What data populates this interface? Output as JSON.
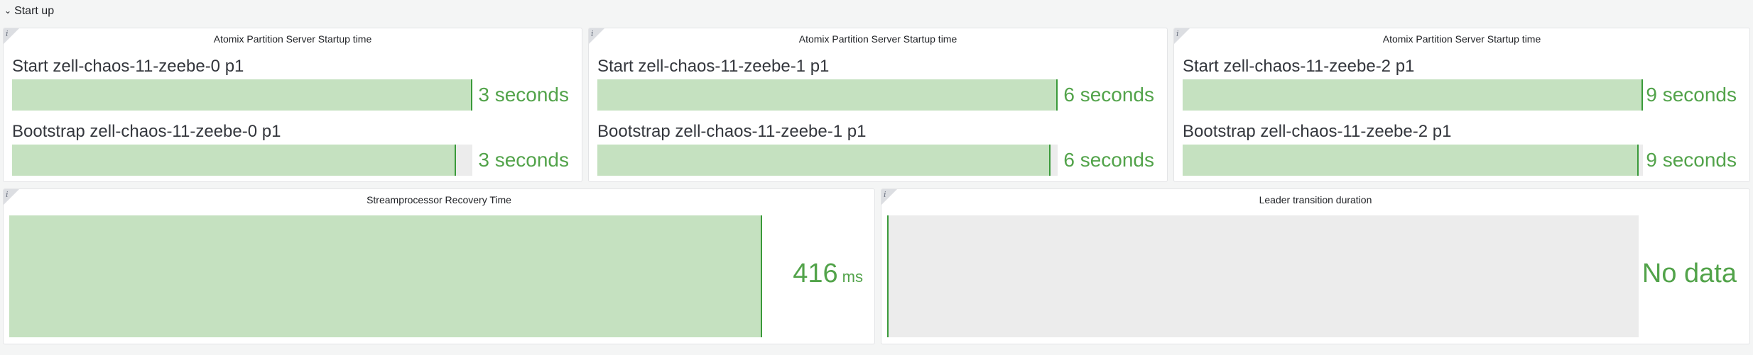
{
  "row": {
    "title": "Start up"
  },
  "panels": [
    {
      "title": "Atomix Partition Server Startup time",
      "gauges": [
        {
          "label": "Start zell-chaos-11-zeebe-0 p1",
          "value": "3 seconds",
          "fill": 1.0
        },
        {
          "label": "Bootstrap zell-chaos-11-zeebe-0 p1",
          "value": "3 seconds",
          "fill": 0.965
        }
      ]
    },
    {
      "title": "Atomix Partition Server Startup time",
      "gauges": [
        {
          "label": "Start zell-chaos-11-zeebe-1 p1",
          "value": "6 seconds",
          "fill": 1.0
        },
        {
          "label": "Bootstrap zell-chaos-11-zeebe-1 p1",
          "value": "6 seconds",
          "fill": 0.985
        }
      ]
    },
    {
      "title": "Atomix Partition Server Startup time",
      "gauges": [
        {
          "label": "Start zell-chaos-11-zeebe-2 p1",
          "value": "9 seconds",
          "fill": 1.0
        },
        {
          "label": "Bootstrap zell-chaos-11-zeebe-2 p1",
          "value": "9 seconds",
          "fill": 0.99
        }
      ]
    }
  ],
  "recovery": {
    "title": "Streamprocessor Recovery Time",
    "value": "416",
    "unit": "ms",
    "fill": 1.0
  },
  "leader": {
    "title": "Leader transition duration",
    "value": "No data"
  },
  "colors": {
    "fill": "#c5e1c0",
    "line": "#3a9a3a",
    "text": "#52a34a",
    "track": "#ececec"
  },
  "icons": {
    "row_toggle": "chevron-down-icon",
    "panel_info": "info-icon"
  }
}
